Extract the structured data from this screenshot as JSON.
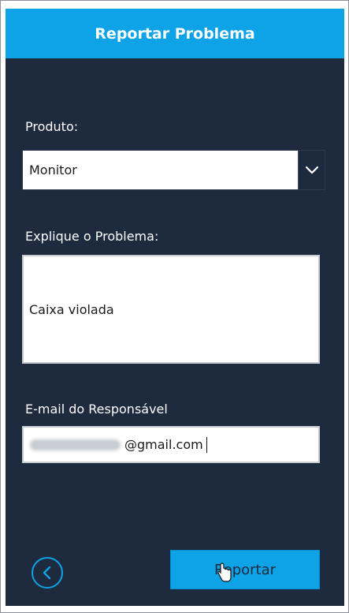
{
  "header": {
    "title": "Reportar Problema"
  },
  "form": {
    "product_label": "Produto:",
    "product_value": "Monitor",
    "problem_label": "Explique o Problema:",
    "problem_value": "Caixa violada",
    "email_label": "E-mail do Responsável",
    "email_visible": "@gmail.com"
  },
  "actions": {
    "back_icon": "chevron-left-icon",
    "report_label": "Reportar"
  },
  "colors": {
    "accent": "#0ea2e7",
    "panel": "#1e2a3d"
  }
}
